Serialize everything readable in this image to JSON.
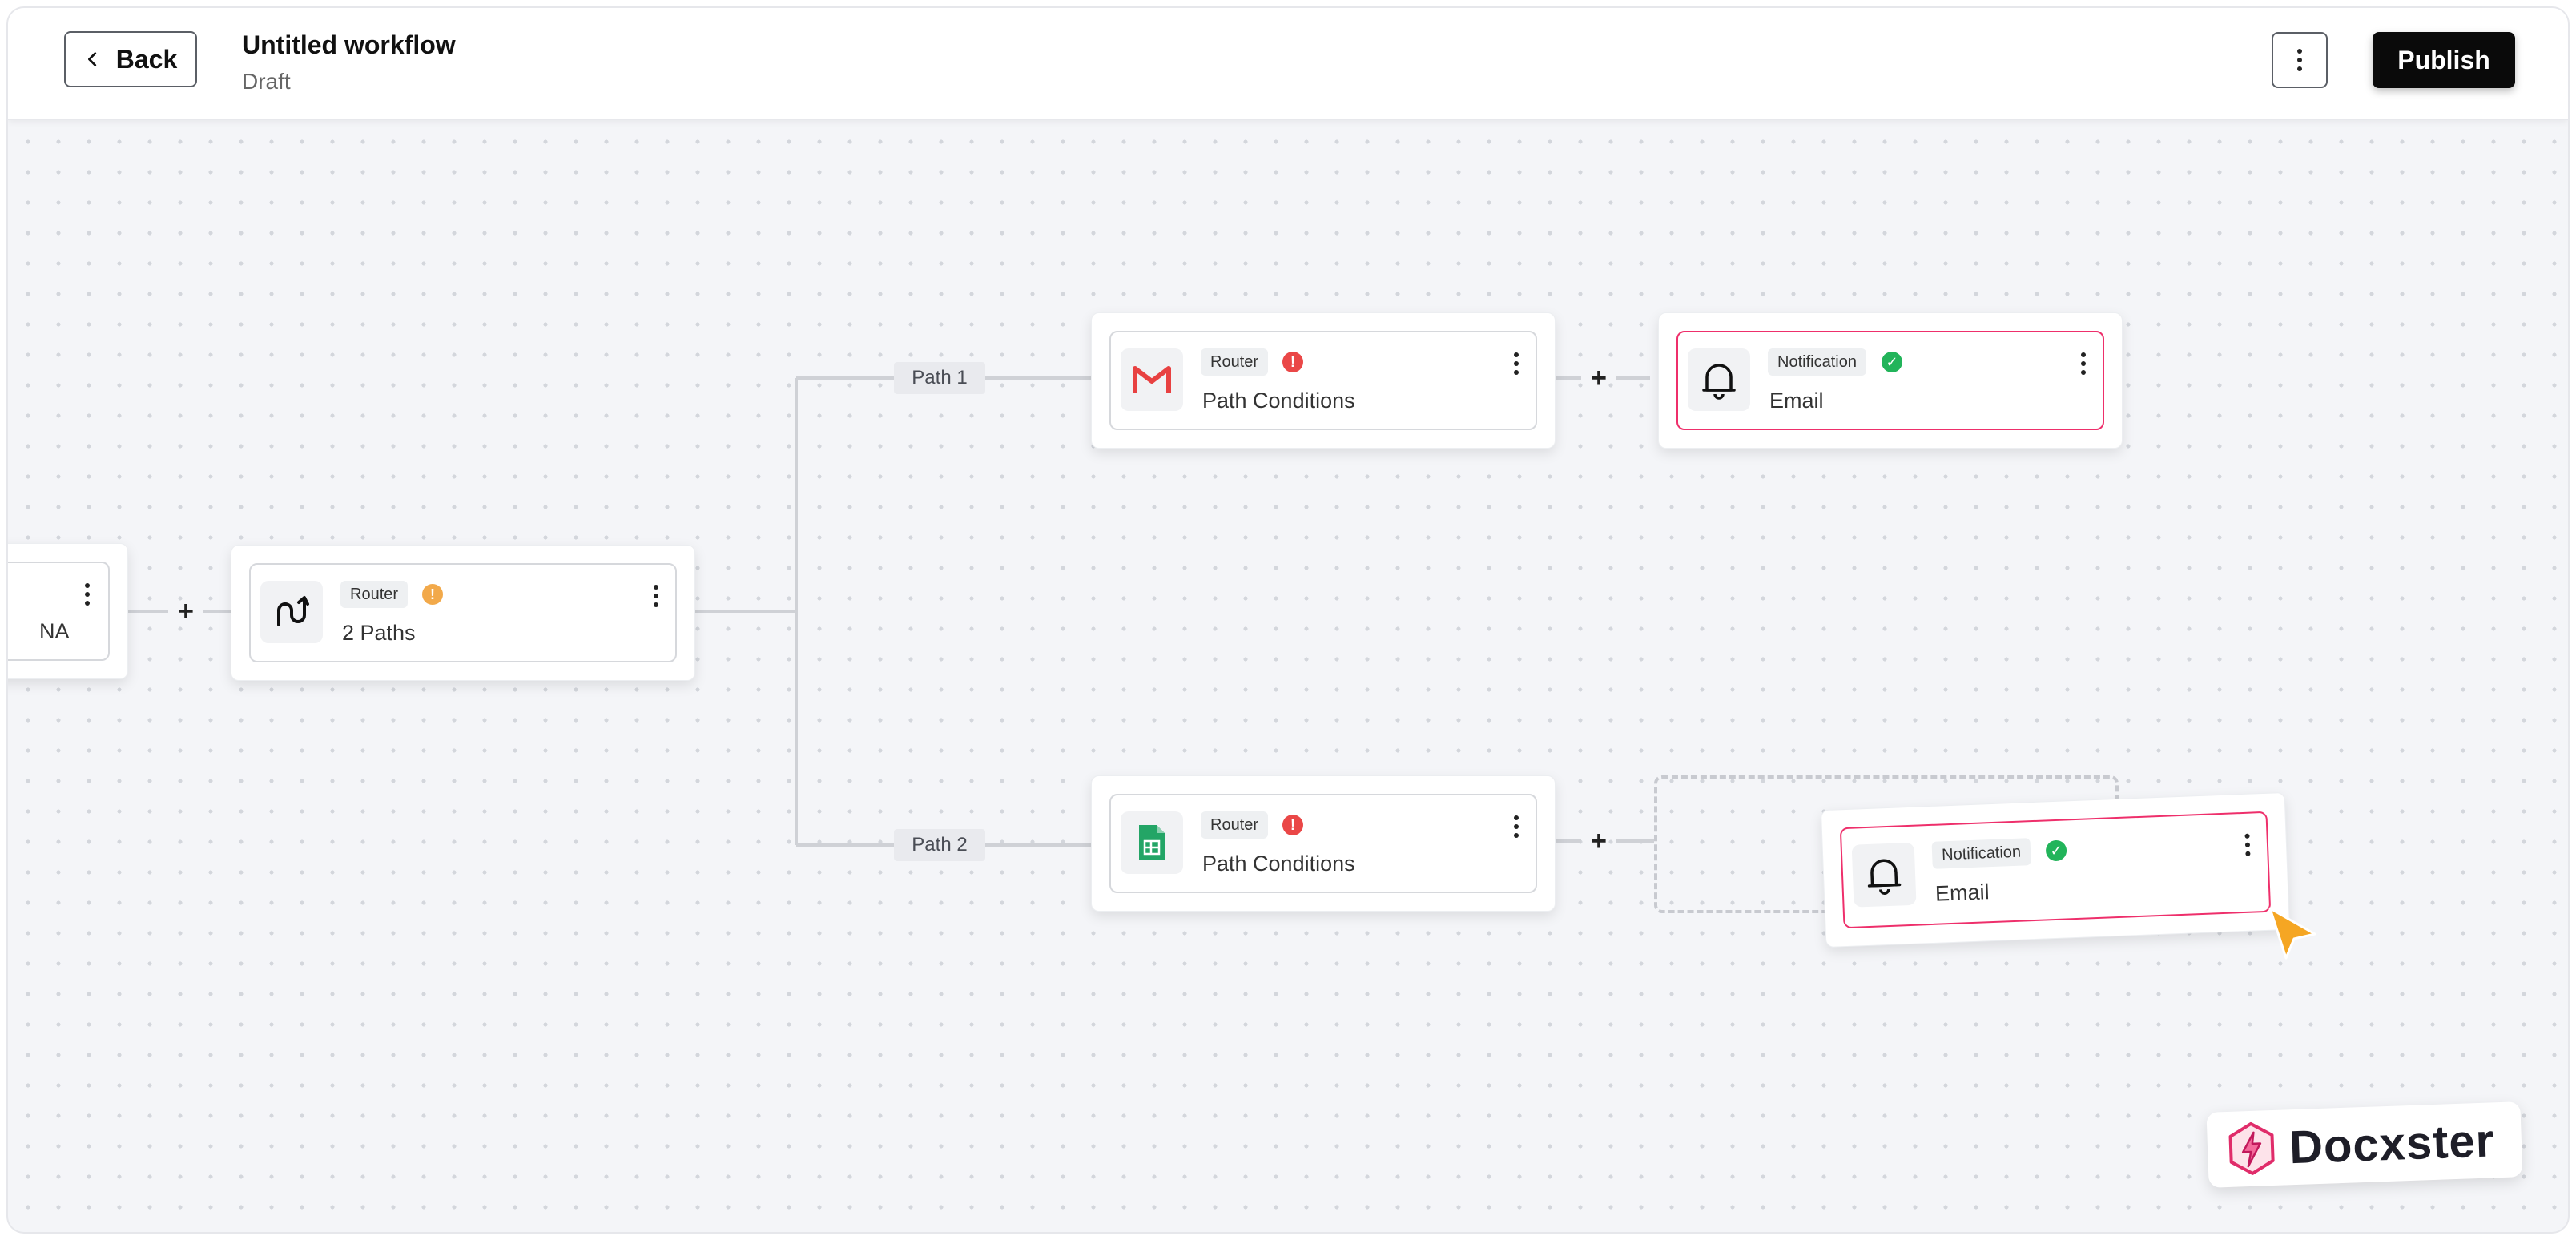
{
  "header": {
    "back_label": "Back",
    "title": "Untitled workflow",
    "status": "Draft",
    "publish_label": "Publish"
  },
  "connectors": {
    "path1_label": "Path 1",
    "path2_label": "Path 2",
    "plus_symbol": "+"
  },
  "nodes": {
    "partial": {
      "title_fragment": "NA"
    },
    "router_main": {
      "badge": "Router",
      "status": "warning",
      "title": "2 Paths",
      "icon": "route-icon"
    },
    "path1_router": {
      "badge": "Router",
      "status": "error",
      "title": "Path Conditions",
      "icon": "gmail-icon"
    },
    "path1_notification": {
      "badge": "Notification",
      "status": "success",
      "title": "Email",
      "icon": "bell-icon"
    },
    "path2_router": {
      "badge": "Router",
      "status": "error",
      "title": "Path Conditions",
      "icon": "google-sheets-icon"
    },
    "dragging_notification": {
      "badge": "Notification",
      "status": "success",
      "title": "Email",
      "icon": "bell-icon"
    }
  },
  "brand": {
    "name": "Docxster"
  },
  "colors": {
    "error": "#ea4747",
    "warning": "#f2a94a",
    "success": "#22b45a",
    "active_border": "#ee2f6b",
    "cursor": "#f5a623"
  }
}
